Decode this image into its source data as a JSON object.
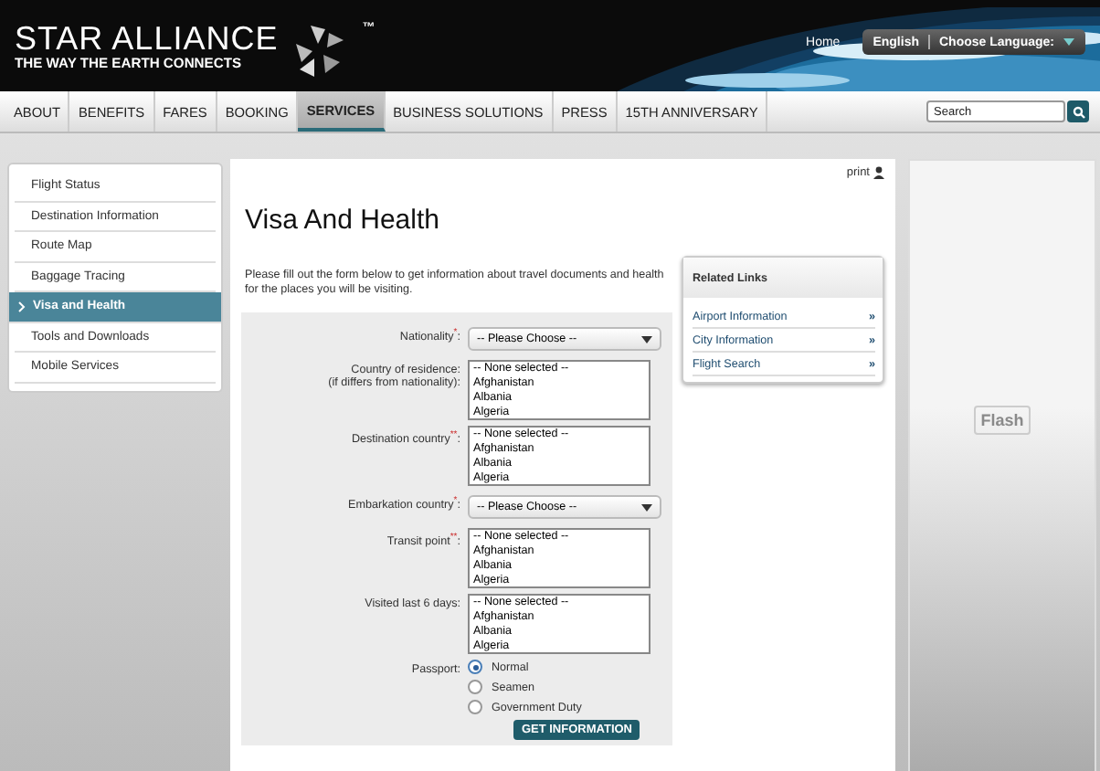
{
  "header": {
    "brand": "STAR ALLIANCE",
    "tagline": "THE WAY THE EARTH CONNECTS",
    "trademark": "™",
    "home_link": "Home",
    "language": "English",
    "language_picker": "Choose Language:"
  },
  "nav": {
    "items": [
      {
        "label": "ABOUT",
        "selected": false
      },
      {
        "label": "BENEFITS",
        "selected": false
      },
      {
        "label": "FARES",
        "selected": false
      },
      {
        "label": "BOOKING",
        "selected": false
      },
      {
        "label": "SERVICES",
        "selected": true
      },
      {
        "label": "BUSINESS SOLUTIONS",
        "selected": false
      },
      {
        "label": "PRESS",
        "selected": false
      },
      {
        "label": "15TH ANNIVERSARY",
        "selected": false
      }
    ],
    "search": {
      "placeholder": "Search"
    }
  },
  "sidebar": {
    "items": [
      {
        "label": "Flight Status",
        "selected": false
      },
      {
        "label": "Destination Information",
        "selected": false
      },
      {
        "label": "Route Map",
        "selected": false
      },
      {
        "label": "Baggage Tracing",
        "selected": false
      },
      {
        "label": "Visa and Health",
        "selected": true
      },
      {
        "label": "Tools and Downloads",
        "selected": false
      },
      {
        "label": "Mobile Services",
        "selected": false
      }
    ]
  },
  "main": {
    "print": "print",
    "title": "Visa And Health",
    "intro": "Please fill out the form below to get information about travel documents and health for the places you will be visiting.",
    "form": {
      "fields": [
        {
          "kind": "select",
          "label": "Nationality$^{*}$:",
          "value": "-- Please Choose --"
        },
        {
          "kind": "listbox",
          "label": "Country of residence:",
          "note": "(if differs from nationality):",
          "options": [
            "-- None selected --",
            "Afghanistan",
            "Albania",
            "Algeria"
          ]
        },
        {
          "kind": "listbox",
          "label": "Destination country$^{**}$:",
          "options": [
            "-- None selected --",
            "Afghanistan",
            "Albania",
            "Algeria"
          ]
        },
        {
          "kind": "select",
          "label": "Embarkation country$^{*}$:",
          "value": "-- Please Choose --"
        },
        {
          "kind": "listbox",
          "label": "Transit point$^{**}$:",
          "options": [
            "-- None selected --",
            "Afghanistan",
            "Albania",
            "Algeria"
          ]
        },
        {
          "kind": "listbox",
          "label": "Visited last 6 days:",
          "options": [
            "-- None selected --",
            "Afghanistan",
            "Albania",
            "Algeria"
          ]
        },
        {
          "kind": "radio",
          "label": "Passport:",
          "options": [
            {
              "label": "Normal",
              "selected": true
            },
            {
              "label": "Seamen",
              "selected": false
            },
            {
              "label": "Government Duty",
              "selected": false
            }
          ]
        }
      ],
      "submit": "GET INFORMATION"
    }
  },
  "related_links": {
    "title": "Related Links",
    "items": [
      {
        "label": "Airport Information",
        "arrow": "»"
      },
      {
        "label": "City Information",
        "arrow": "»"
      },
      {
        "label": "Flight Search",
        "arrow": "»"
      }
    ]
  },
  "flash": {
    "label": "Flash"
  }
}
